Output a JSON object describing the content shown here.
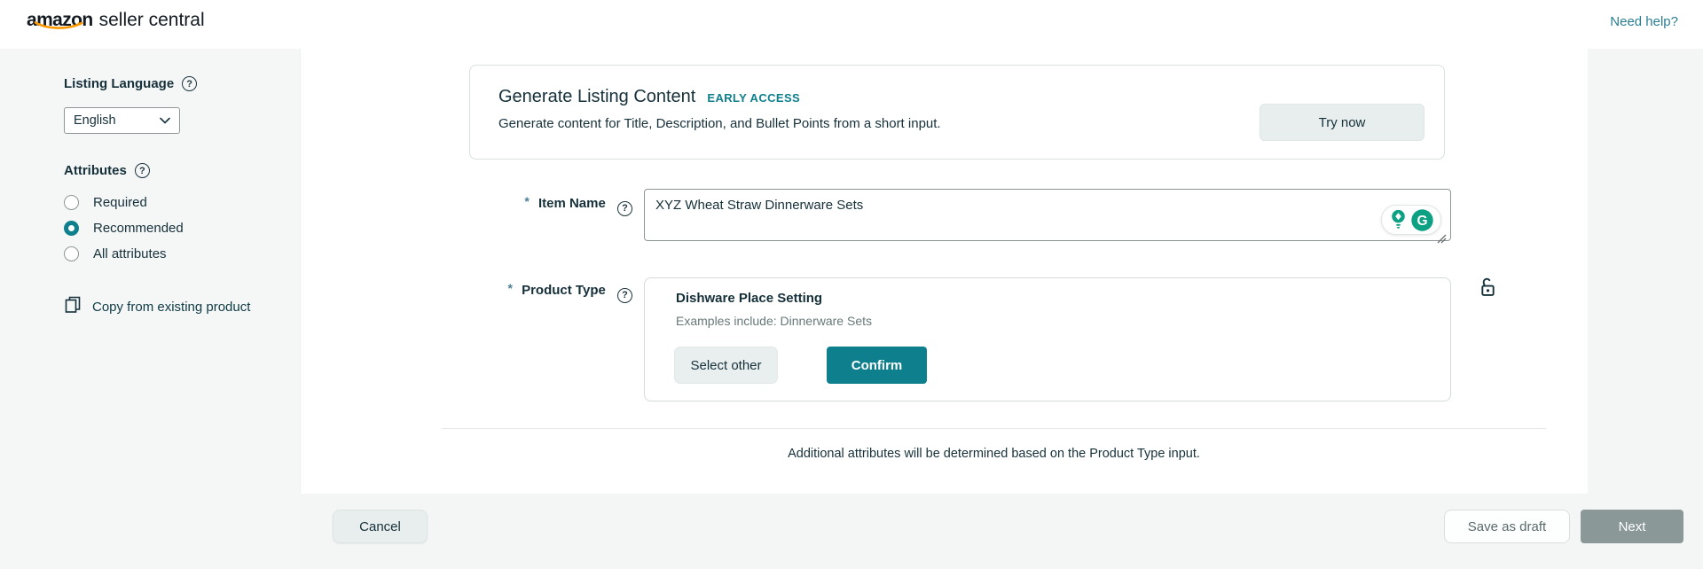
{
  "header": {
    "logo_amazon": "amazon",
    "logo_suffix": "seller central",
    "need_help_label": "Need help?"
  },
  "sidebar": {
    "listing_language_label": "Listing Language",
    "language_value": "English",
    "attributes_label": "Attributes",
    "attribute_options": [
      {
        "label": "Required",
        "selected": false
      },
      {
        "label": "Recommended",
        "selected": true
      },
      {
        "label": "All attributes",
        "selected": false
      }
    ],
    "copy_from_existing_label": "Copy from existing product"
  },
  "generate_card": {
    "title": "Generate Listing Content",
    "badge": "EARLY ACCESS",
    "subtitle": "Generate content for Title, Description, and Bullet Points from a short input.",
    "try_now_label": "Try now"
  },
  "form": {
    "item_name": {
      "required_marker": "*",
      "label": "Item Name",
      "value": "XYZ Wheat Straw Dinnerware Sets"
    },
    "product_type": {
      "required_marker": "*",
      "label": "Product Type",
      "selected_name": "Dishware Place Setting",
      "examples": "Examples include: Dinnerware Sets",
      "select_other_label": "Select other",
      "confirm_label": "Confirm"
    },
    "note": "Additional attributes will be determined based on the Product Type input."
  },
  "footer": {
    "cancel_label": "Cancel",
    "save_as_draft_label": "Save as draft",
    "next_label": "Next"
  },
  "icons": {
    "help_glyph": "?",
    "grammarly_g": "G"
  },
  "colors": {
    "teal": "#0e7f8d",
    "link": "#2b7e93",
    "grammarly_green": "#0da183",
    "amazon_orange": "#ff9900",
    "dark_text": "#16303a",
    "secondary_text": "#687878",
    "light_button_bg": "#e8eded",
    "next_button_bg": "#8b9898",
    "sidebar_bg": "#f5f7f7"
  }
}
